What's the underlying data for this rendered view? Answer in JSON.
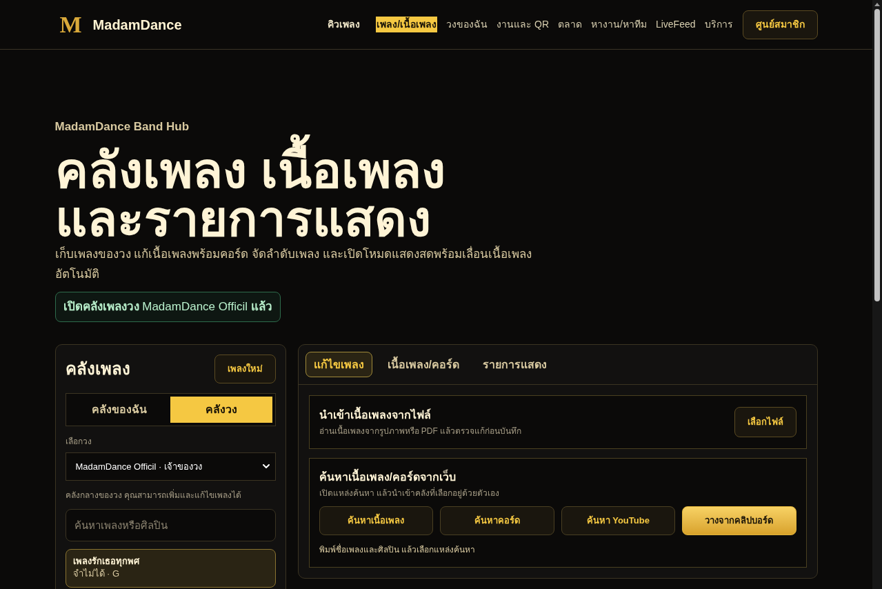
{
  "header": {
    "logo_mark": "M",
    "brand": "MadamDance",
    "nav": [
      {
        "label": "คิวเพลง",
        "kind": "strong",
        "selected": false
      },
      {
        "label": "เพลง/เนื้อเพลง",
        "kind": "link",
        "selected": true
      },
      {
        "label": "วงของฉัน",
        "kind": "link",
        "selected": false
      },
      {
        "label": "งานและ QR",
        "kind": "link",
        "selected": false
      },
      {
        "label": "ตลาด",
        "kind": "link",
        "selected": false
      },
      {
        "label": "หางาน/หาทีม",
        "kind": "link",
        "selected": false
      },
      {
        "label": "LiveFeed",
        "kind": "link",
        "selected": false
      },
      {
        "label": "บริการ",
        "kind": "link",
        "selected": false
      }
    ],
    "member_button": "ศูนย์สมาชิก"
  },
  "hero": {
    "eyebrow": "MadamDance Band Hub",
    "title_lines": [
      "คลังเพลง เนื้อเพลง",
      "และรายการแสดง"
    ],
    "description": "เก็บเพลงของวง แก้เนื้อเพลงพร้อมคอร์ด จัดลำดับเพลง และเปิดโหมดแสดงสดพร้อมเลื่อนเนื้อเพลงอัตโนมัติ",
    "status": "**เปิดคลังเพลงวง** MadamDance Officil **แล้ว**"
  },
  "library": {
    "title": "คลังเพลง",
    "new_button": "เพลงใหม่",
    "scopes": [
      {
        "label": "คลังของฉัน",
        "selected": false
      },
      {
        "label": "คลังวง",
        "selected": true
      }
    ],
    "band_label": "เลือกวง",
    "band_select": "MadamDance Officil · เจ้าของวง",
    "band_note": "คลังกลางของวง คุณสามารถเพิ่มและแก้ไขเพลงได้",
    "search": {
      "placeholder": "ค้นหาเพลงหรือศิลปิน"
    },
    "songs": [
      {
        "title": "เพลงรักเธอทุกพศ",
        "meta": "จำไม่ได้ · G",
        "selected": true
      }
    ]
  },
  "editor": {
    "tabs": [
      {
        "label": "แก้ไขเพลง",
        "selected": true
      },
      {
        "label": "เนื้อเพลง/คอร์ด",
        "selected": false
      },
      {
        "label": "รายการแสดง",
        "selected": false
      }
    ],
    "import_card": {
      "title": "นำเข้าเนื้อเพลงจากไฟล์",
      "description": "อ่านเนื้อเพลงจากรูปภาพหรือ PDF แล้วตรวจแก้ก่อนบันทึก",
      "button": "เลือกไฟล์"
    },
    "web_search": {
      "title": "ค้นหาเนื้อเพลง/คอร์ดจากเว็บ",
      "description": "เปิดแหล่งค้นหา แล้วนำเข้าคลังที่เลือกอยู่ด้วยตัวเอง",
      "buttons": [
        {
          "label": "ค้นหาเนื้อเพลง",
          "kind": "secondary"
        },
        {
          "label": "ค้นหาคอร์ด",
          "kind": "secondary"
        },
        {
          "label": "ค้นหา YouTube",
          "kind": "secondary"
        },
        {
          "label": "วางจากคลิปบอร์ด",
          "kind": "primary"
        }
      ],
      "hint": "พิมพ์ชื่อเพลงและศิลปิน แล้วเลือกแหล่งค้นหา"
    }
  }
}
